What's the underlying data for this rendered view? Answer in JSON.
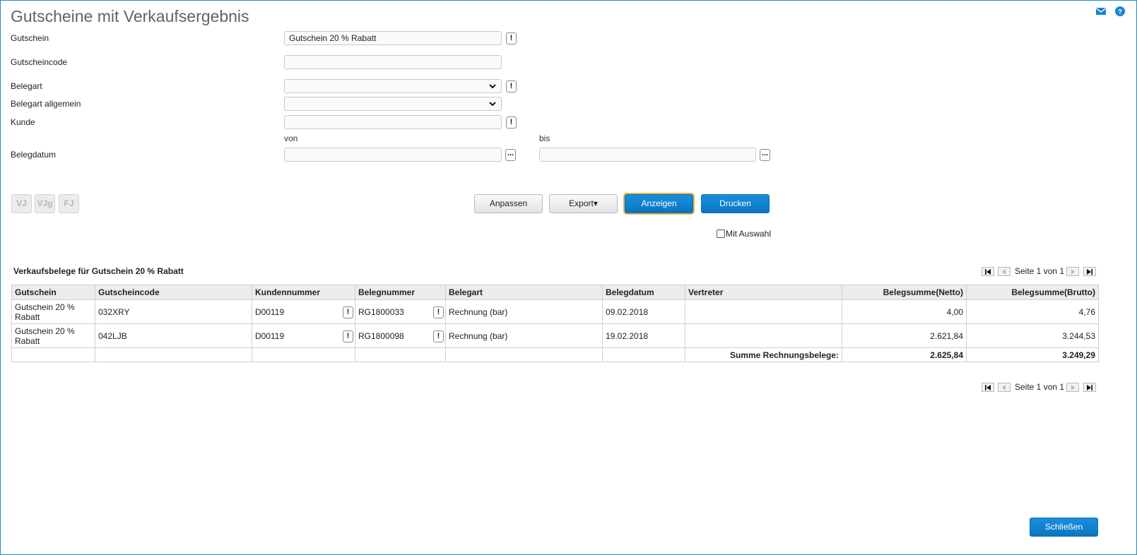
{
  "title": "Gutscheine mit Verkaufsergebnis",
  "form": {
    "gutschein_label": "Gutschein",
    "gutschein_value": "Gutschein 20 % Rabatt",
    "gutscheincode_label": "Gutscheincode",
    "gutscheincode_value": "",
    "belegart_label": "Belegart",
    "belegart_value": "",
    "belegart_allgemein_label": "Belegart allgemein",
    "belegart_allgemein_value": "",
    "kunde_label": "Kunde",
    "kunde_value": "",
    "von_label": "von",
    "bis_label": "bis",
    "belegdatum_label": "Belegdatum",
    "belegdatum_von": "",
    "belegdatum_bis": "",
    "lookup_glyph": "!",
    "picker_glyph": "..."
  },
  "journal_buttons": [
    "VJ",
    "VJg",
    "FJ"
  ],
  "actions": {
    "anpassen": "Anpassen",
    "export": "Export▾",
    "anzeigen": "Anzeigen",
    "drucken": "Drucken"
  },
  "mit_auswahl_label": "Mit Auswahl",
  "section_title": "Verkaufsbelege für Gutschein 20 % Rabatt",
  "pager": {
    "text": "Seite 1 von 1"
  },
  "table": {
    "headers": [
      "Gutschein",
      "Gutscheincode",
      "Kundennummer",
      "Belegnummer",
      "Belegart",
      "Belegdatum",
      "Vertreter",
      "Belegsumme(Netto)",
      "Belegsumme(Brutto)"
    ],
    "rows": [
      [
        "Gutschein 20 % Rabatt",
        "032XRY",
        "D00119",
        "RG1800033",
        "Rechnung (bar)",
        "09.02.2018",
        "",
        "4,00",
        "4,76"
      ],
      [
        "Gutschein 20 % Rabatt",
        "042LJB",
        "D00119",
        "RG1800098",
        "Rechnung (bar)",
        "19.02.2018",
        "",
        "2.621,84",
        "3.244,53"
      ]
    ],
    "sum_label": "Summe Rechnungsbelege:",
    "sum_netto": "2.625,84",
    "sum_brutto": "3.249,29"
  },
  "close_label": "Schließen",
  "colors": {
    "accent": "#0a75c2",
    "focus": "#f0b548",
    "frame": "#1f8fc9"
  },
  "icons": [
    "mail-icon",
    "help-icon",
    "chevron-down-icon",
    "first-page-icon",
    "prev-page-icon",
    "next-page-icon",
    "last-page-icon"
  ]
}
